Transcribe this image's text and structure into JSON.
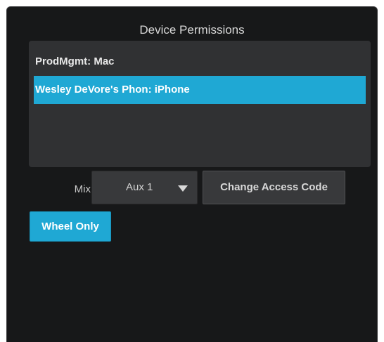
{
  "dialog": {
    "title": "Device Permissions"
  },
  "devices": [
    {
      "label": "ProdMgmt: Mac",
      "selected": false
    },
    {
      "label": "Wesley DeVore's Phon: iPhone",
      "selected": true
    }
  ],
  "mix": {
    "label": "Mix",
    "selected_value": "Aux 1",
    "dropdown_icon": "triangle-down-icon"
  },
  "buttons": {
    "change_access_code": "Change Access Code",
    "wheel_only": "Wheel Only"
  },
  "colors": {
    "background": "#171819",
    "panel": "#303133",
    "accent": "#1fa8d4",
    "control": "#38393b"
  }
}
